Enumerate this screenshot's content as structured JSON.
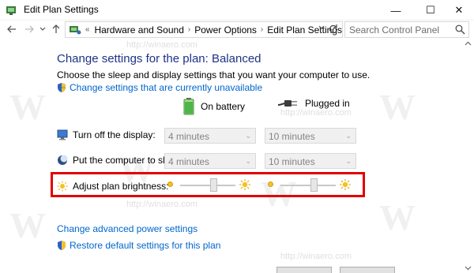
{
  "window": {
    "title": "Edit Plan Settings",
    "minimize_glyph": "—",
    "maximize_glyph": "☐",
    "close_glyph": "✕"
  },
  "nav": {
    "breadcrumb": [
      "Hardware and Sound",
      "Power Options",
      "Edit Plan Settings"
    ],
    "double_chevron": "«",
    "separator": "›",
    "search_placeholder": "Search Control Panel"
  },
  "main": {
    "heading": "Change settings for the plan: Balanced",
    "subtext": "Choose the sleep and display settings that you want your computer to use.",
    "unavailable_link": "Change settings that are currently unavailable",
    "columns": {
      "battery": "On battery",
      "plugged": "Plugged in"
    },
    "rows": {
      "display": {
        "label": "Turn off the display:",
        "battery": "4 minutes",
        "plugged": "10 minutes"
      },
      "sleep": {
        "label": "Put the computer to sleep:",
        "battery": "4 minutes",
        "plugged": "10 minutes"
      },
      "brightness": {
        "label": "Adjust plan brightness:",
        "battery_level": 0.6,
        "plugged_level": 0.6
      }
    },
    "advanced_link": "Change advanced power settings",
    "restore_link": "Restore default settings for this plan"
  },
  "watermark": {
    "text": "http://winaero.com",
    "letter": "W"
  },
  "colors": {
    "heading": "#1e3287",
    "link": "#0066cc",
    "highlight": "#e00000"
  }
}
